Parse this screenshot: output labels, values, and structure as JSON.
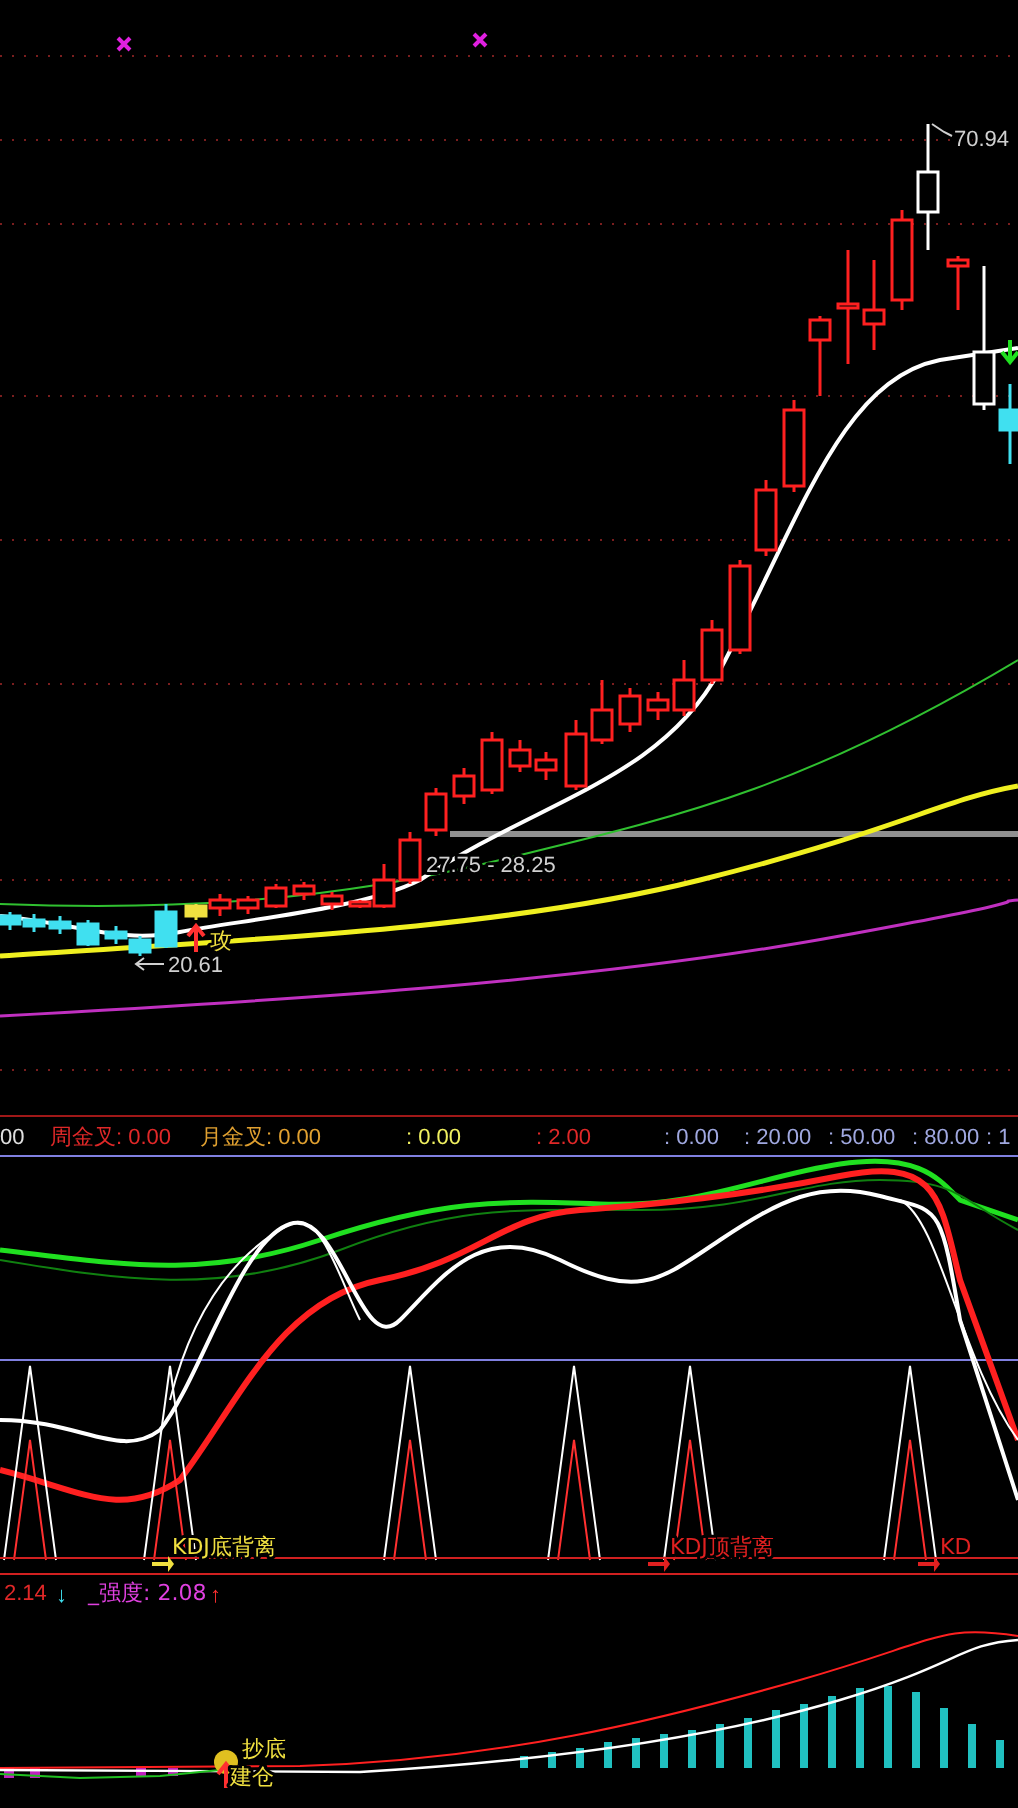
{
  "price_labels": {
    "high": "70.94",
    "range": "27.75 - 28.25",
    "low": "20.61",
    "signal": "攻"
  },
  "indicator_legend": [
    {
      "text": "00",
      "color": "#e0e0e0"
    },
    {
      "text": "周金叉: 0.00",
      "color": "#e02828"
    },
    {
      "text": "月金叉: 0.00",
      "color": "#e0a030"
    },
    {
      "text": ": 0.00",
      "color": "#f0f060"
    },
    {
      "text": ": 2.00",
      "color": "#e02828"
    },
    {
      "text": ": 0.00",
      "color": "#a0a8e0"
    },
    {
      "text": ": 20.00",
      "color": "#a0a8e0"
    },
    {
      "text": ": 50.00",
      "color": "#a0a8e0"
    },
    {
      "text": ": 80.00",
      "color": "#a0a8e0"
    },
    {
      "text": ": 1",
      "color": "#a0a8e0"
    }
  ],
  "divergence_signals": [
    {
      "text": "KDJ底背离",
      "color": "#f0e040"
    },
    {
      "text": "KDJ顶背离",
      "color": "#e02020"
    },
    {
      "text": "KD",
      "color": "#e02020"
    }
  ],
  "strength": {
    "value": "2.14",
    "value_arrow": "↓",
    "label": "_强度: 2.08",
    "label_arrow": "↑"
  },
  "bottom_signals": [
    "抄底",
    "建仓"
  ]
}
